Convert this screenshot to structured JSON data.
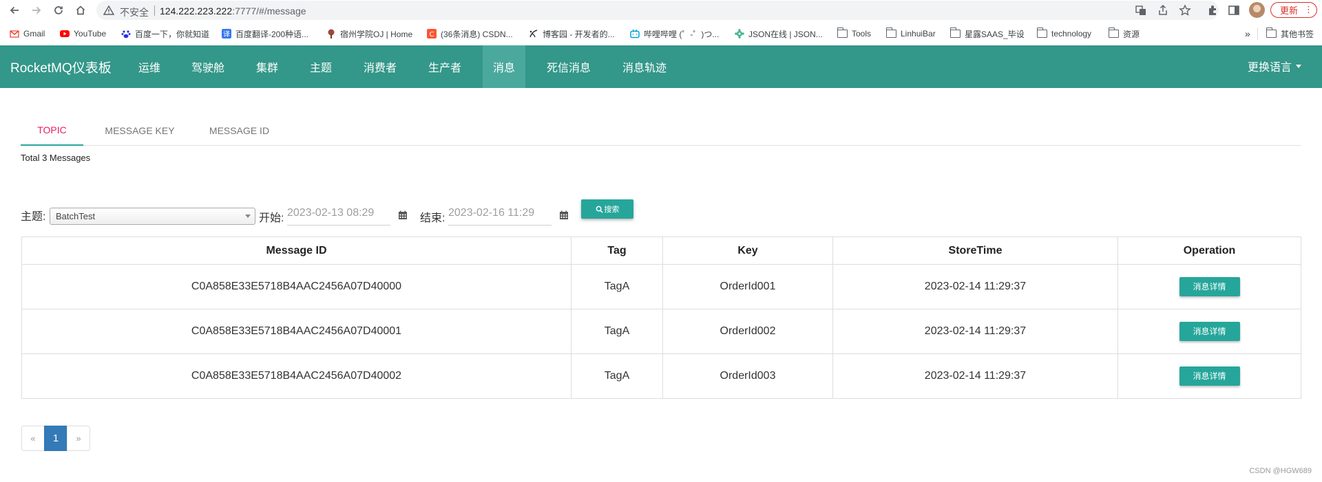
{
  "browser": {
    "insecure_label": "不安全",
    "url_host": "124.222.223.222",
    "url_path": ":7777/#/message",
    "update_label": "更新"
  },
  "bookmarks": {
    "items": [
      {
        "label": "Gmail",
        "icon": "gmail-icon",
        "color": "#ea4335"
      },
      {
        "label": "YouTube",
        "icon": "youtube-icon",
        "color": "#ff0000"
      },
      {
        "label": "百度一下，你就知道",
        "icon": "baidu-icon",
        "color": "#2932e1"
      },
      {
        "label": "百度翻译-200种语...",
        "icon": "translate-icon",
        "color": "#3577f1"
      },
      {
        "label": "宿州学院OJ | Home",
        "icon": "tree-icon",
        "color": "#a1453d"
      },
      {
        "label": "(36条消息) CSDN...",
        "icon": "csdn-icon",
        "color": "#fc5531"
      },
      {
        "label": "博客园 - 开发者的...",
        "icon": "cnblogs-icon",
        "color": "#333333"
      },
      {
        "label": "哔哩哔哩 (゜-゜)つ...",
        "icon": "bilibili-icon",
        "color": "#00a1d6"
      },
      {
        "label": "JSON在线 | JSON...",
        "icon": "json-icon",
        "color": "#3fb28a"
      },
      {
        "label": "Tools",
        "icon": "folder-icon"
      },
      {
        "label": "LinhuiBar",
        "icon": "folder-icon"
      },
      {
        "label": "星露SAAS_毕设",
        "icon": "folder-icon"
      },
      {
        "label": "technology",
        "icon": "folder-icon"
      },
      {
        "label": "资源",
        "icon": "folder-icon"
      }
    ],
    "overflow": "»",
    "other_bookmarks": "其他书签"
  },
  "navbar": {
    "brand": "RocketMQ仪表板",
    "items": [
      "运维",
      "驾驶舱",
      "集群",
      "主题",
      "消费者",
      "生产者",
      "消息",
      "死信消息",
      "消息轨迹"
    ],
    "active": "消息",
    "language": "更换语言",
    "color": "#339789"
  },
  "tabs": {
    "items": [
      "TOPIC",
      "MESSAGE KEY",
      "MESSAGE ID"
    ],
    "active": "TOPIC"
  },
  "summary": "Total 3 Messages",
  "search": {
    "topic_label": "主题:",
    "topic_value": "BatchTest",
    "start_label": "开始:",
    "start_value": "2023-02-13 08:29",
    "end_label": "结束:",
    "end_value": "2023-02-16 11:29",
    "button_label": "搜索"
  },
  "table": {
    "headers": [
      "Message ID",
      "Tag",
      "Key",
      "StoreTime",
      "Operation"
    ],
    "rows": [
      {
        "id": "C0A858E33E5718B4AAC2456A07D40000",
        "tag": "TagA",
        "key": "OrderId001",
        "time": "2023-02-14 11:29:37",
        "action": "消息详情"
      },
      {
        "id": "C0A858E33E5718B4AAC2456A07D40001",
        "tag": "TagA",
        "key": "OrderId002",
        "time": "2023-02-14 11:29:37",
        "action": "消息详情"
      },
      {
        "id": "C0A858E33E5718B4AAC2456A07D40002",
        "tag": "TagA",
        "key": "OrderId003",
        "time": "2023-02-14 11:29:37",
        "action": "消息详情"
      }
    ]
  },
  "pagination": {
    "prev": "«",
    "current": "1",
    "next": "»"
  },
  "watermark": "CSDN @HGW689",
  "accent_color": "#26a69a"
}
